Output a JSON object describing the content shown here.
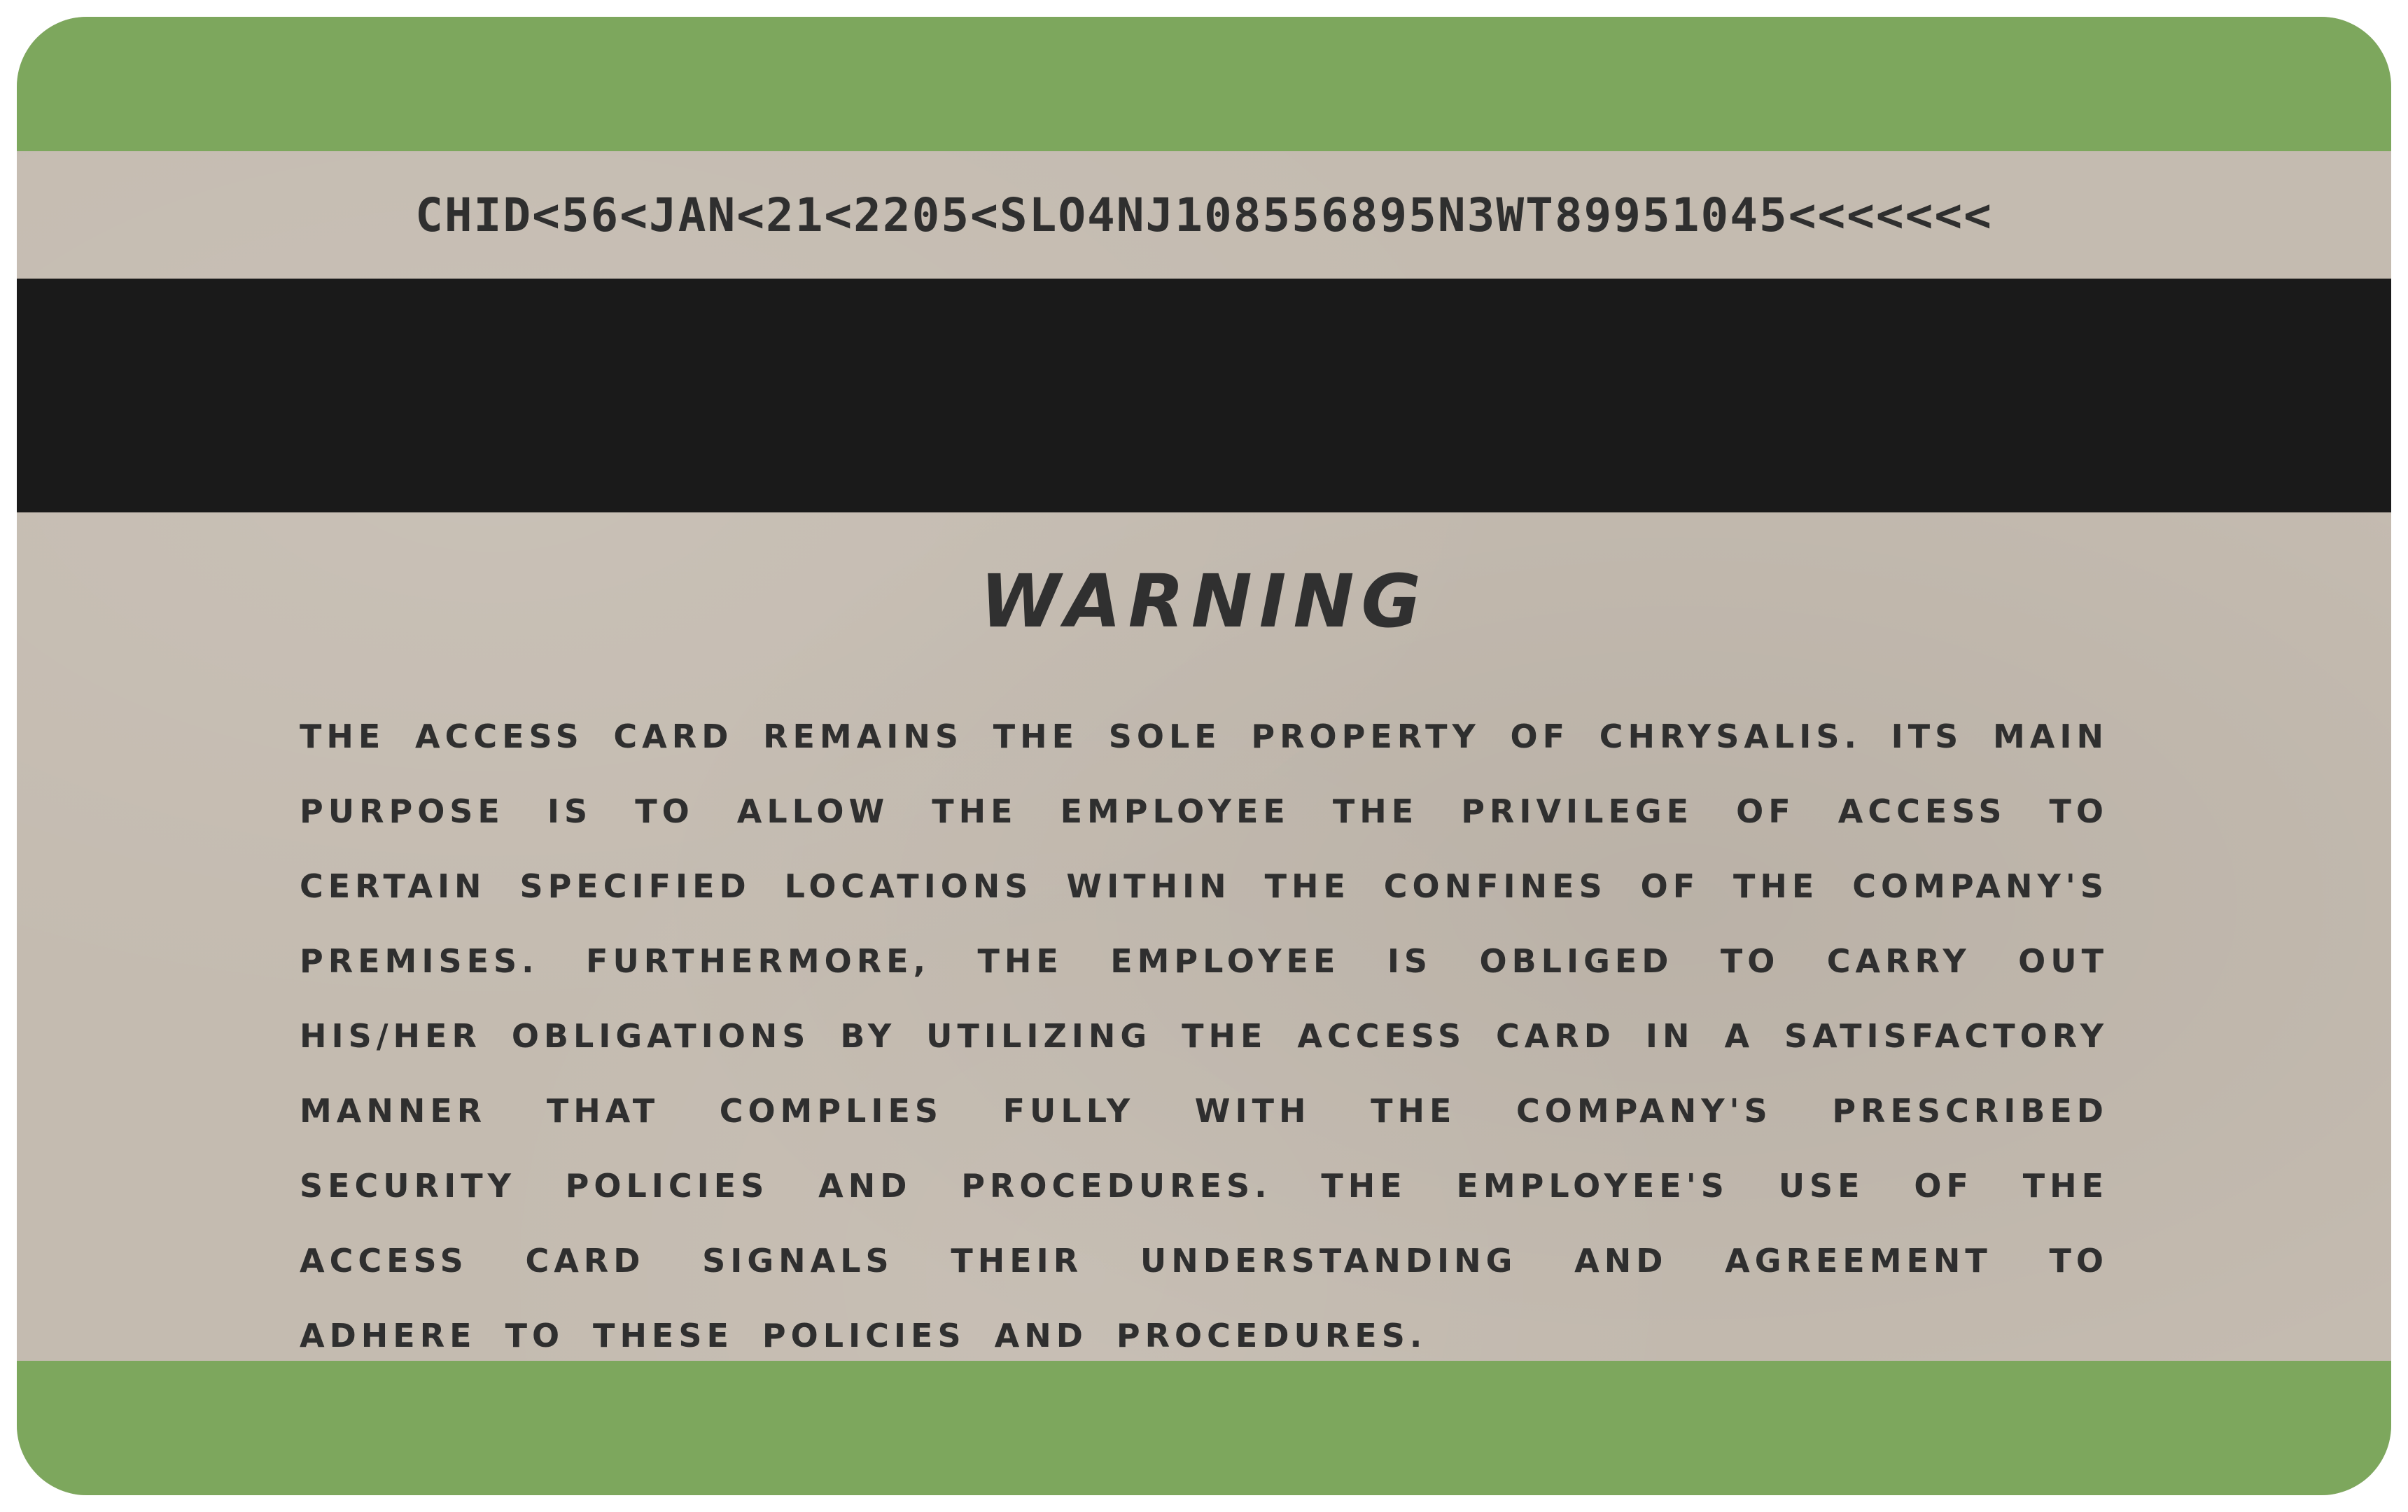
{
  "card": {
    "mrz_line": "CHID<56<JAN<21<2205<SLO4NJ108556895N3WT89951045<<<<<<<",
    "warning_title": "WARNING",
    "warning_text": "The access card remains the sole property of Chrysalis. Its main purpose is to allow the employee the privilege of access to certain specified locations within the confines of the company's premises. Furthermore, the employee is obliged to carry out his/her obligations by utilizing the access card in a satisfactory manner that complies fully with the company's prescribed security policies and procedures. The employee's use of the access card signals their understanding and agreement to adhere to these policies and procedures."
  },
  "colors": {
    "stripe_green": "#7da75d",
    "card_body": "#c4bbb0",
    "magnetic_stripe": "#1a1a1a",
    "text": "#2f2f2f"
  }
}
